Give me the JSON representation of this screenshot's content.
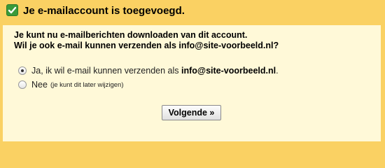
{
  "header": {
    "title": "Je e-mailaccount is toegevoegd.",
    "icon": "checkmark-icon"
  },
  "intro": {
    "line1": "Je kunt nu e-mailberichten downloaden van dit account.",
    "line2": "Wil je ook e-mail kunnen verzenden als info@site-voorbeeld.nl?"
  },
  "options": [
    {
      "label_prefix": "Ja, ik wil e-mail kunnen verzenden als ",
      "label_bold": "info@site-voorbeeld.nl",
      "label_suffix": ".",
      "checked": true
    },
    {
      "label": "Nee",
      "hint": "(je kunt dit later wijzigen)",
      "checked": false
    }
  ],
  "buttons": {
    "next_label": "Volgende »"
  },
  "colors": {
    "header_background": "#fad163",
    "panel_background": "#fff9d8",
    "check_green": "#3a9a3a"
  }
}
